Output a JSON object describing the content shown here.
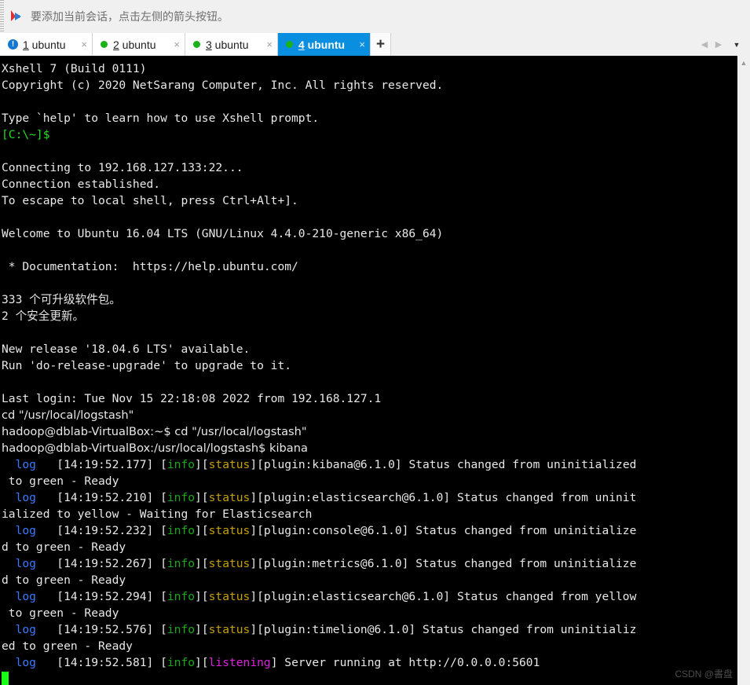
{
  "notification": {
    "icon": "arrow-pin-icon",
    "text": "要添加当前会话，点击左侧的箭头按钮。"
  },
  "tabs": {
    "items": [
      {
        "number": "1",
        "name": " ubuntu",
        "status": "warning",
        "status_icon": "exclamation-circle-icon",
        "active": false,
        "close_label": "×"
      },
      {
        "number": "2",
        "name": " ubuntu",
        "status": "connected",
        "status_icon": "green-dot-icon",
        "active": false,
        "close_label": "×"
      },
      {
        "number": "3",
        "name": " ubuntu",
        "status": "connected",
        "status_icon": "green-dot-icon",
        "active": false,
        "close_label": "×"
      },
      {
        "number": "4",
        "name": " ubuntu",
        "status": "connected",
        "status_icon": "green-dot-icon",
        "active": true,
        "close_label": "×"
      }
    ],
    "add_label": "+",
    "warning_glyph": "!",
    "nav_prev": "◀",
    "nav_next": "▶",
    "nav_menu": "▼"
  },
  "terminal": {
    "colors": {
      "background": "#000000",
      "foreground": "#e8e8e8",
      "green": "#20e020",
      "blue": "#3b78ff",
      "olive": "#c5a000",
      "info_green": "#1aa81a",
      "magenta": "#e020e0",
      "cursor": "#17ff17"
    },
    "lines": [
      {
        "type": "text",
        "color": "white",
        "text": "Xshell 7 (Build 0111)"
      },
      {
        "type": "text",
        "color": "white",
        "text": "Copyright (c) 2020 NetSarang Computer, Inc. All rights reserved."
      },
      {
        "type": "blank"
      },
      {
        "type": "text",
        "color": "white",
        "text": "Type `help' to learn how to use Xshell prompt."
      },
      {
        "type": "text",
        "color": "green",
        "text": "[C:\\~]$"
      },
      {
        "type": "blank"
      },
      {
        "type": "text",
        "color": "white",
        "text": "Connecting to 192.168.127.133:22..."
      },
      {
        "type": "text",
        "color": "white",
        "text": "Connection established."
      },
      {
        "type": "text",
        "color": "white",
        "text": "To escape to local shell, press Ctrl+Alt+]."
      },
      {
        "type": "blank"
      },
      {
        "type": "text",
        "color": "white",
        "text": "Welcome to Ubuntu 16.04 LTS (GNU/Linux 4.4.0-210-generic x86_64)"
      },
      {
        "type": "blank"
      },
      {
        "type": "text",
        "color": "white",
        "text": " * Documentation:  https://help.ubuntu.com/"
      },
      {
        "type": "blank"
      },
      {
        "type": "text",
        "color": "white",
        "text": "333 个可升级软件包。"
      },
      {
        "type": "text",
        "color": "white",
        "text": "2 个安全更新。"
      },
      {
        "type": "blank"
      },
      {
        "type": "text",
        "color": "white",
        "text": "New release '18.04.6 LTS' available."
      },
      {
        "type": "text",
        "color": "white",
        "text": "Run 'do-release-upgrade' to upgrade to it."
      },
      {
        "type": "blank"
      },
      {
        "type": "text",
        "color": "white",
        "text": "Last login: Tue Nov 15 22:18:08 2022 from 192.168.127.1"
      },
      {
        "type": "prompt",
        "color": "white",
        "text": "cd \"/usr/local/logstash\""
      },
      {
        "type": "prompt",
        "color": "white",
        "text": "hadoop@dblab-VirtualBox:~$ cd \"/usr/local/logstash\""
      },
      {
        "type": "prompt",
        "color": "white",
        "text": "hadoop@dblab-VirtualBox:/usr/local/logstash$ kibana"
      }
    ],
    "log_entries": [
      {
        "tag": "log",
        "timestamp": "[14:19:52.177]",
        "level": "info",
        "category": "status",
        "category_color": "olive",
        "plugin": "[plugin:kibana@6.1.0]",
        "message": " Status changed from uninitialized",
        "continuation": " to green - Ready"
      },
      {
        "tag": "log",
        "timestamp": "[14:19:52.210]",
        "level": "info",
        "category": "status",
        "category_color": "olive",
        "plugin": "[plugin:elasticsearch@6.1.0]",
        "message": " Status changed from uninit",
        "continuation": "ialized to yellow - Waiting for Elasticsearch"
      },
      {
        "tag": "log",
        "timestamp": "[14:19:52.232]",
        "level": "info",
        "category": "status",
        "category_color": "olive",
        "plugin": "[plugin:console@6.1.0]",
        "message": " Status changed from uninitialize",
        "continuation": "d to green - Ready"
      },
      {
        "tag": "log",
        "timestamp": "[14:19:52.267]",
        "level": "info",
        "category": "status",
        "category_color": "olive",
        "plugin": "[plugin:metrics@6.1.0]",
        "message": " Status changed from uninitialize",
        "continuation": "d to green - Ready"
      },
      {
        "tag": "log",
        "timestamp": "[14:19:52.294]",
        "level": "info",
        "category": "status",
        "category_color": "olive",
        "plugin": "[plugin:elasticsearch@6.1.0]",
        "message": " Status changed from yellow",
        "continuation": " to green - Ready"
      },
      {
        "tag": "log",
        "timestamp": "[14:19:52.576]",
        "level": "info",
        "category": "status",
        "category_color": "olive",
        "plugin": "[plugin:timelion@6.1.0]",
        "message": " Status changed from uninitializ",
        "continuation": "ed to green - Ready"
      },
      {
        "tag": "log",
        "timestamp": "[14:19:52.581]",
        "level": "info",
        "category": "listening",
        "category_color": "magenta",
        "plugin": "",
        "message": " Server running at http://0.0.0.0:5601",
        "continuation": ""
      }
    ]
  },
  "scrollbar": {
    "up_arrow": "▲",
    "down_arrow": "▼"
  },
  "watermark": {
    "text": "CSDN @書盘"
  }
}
